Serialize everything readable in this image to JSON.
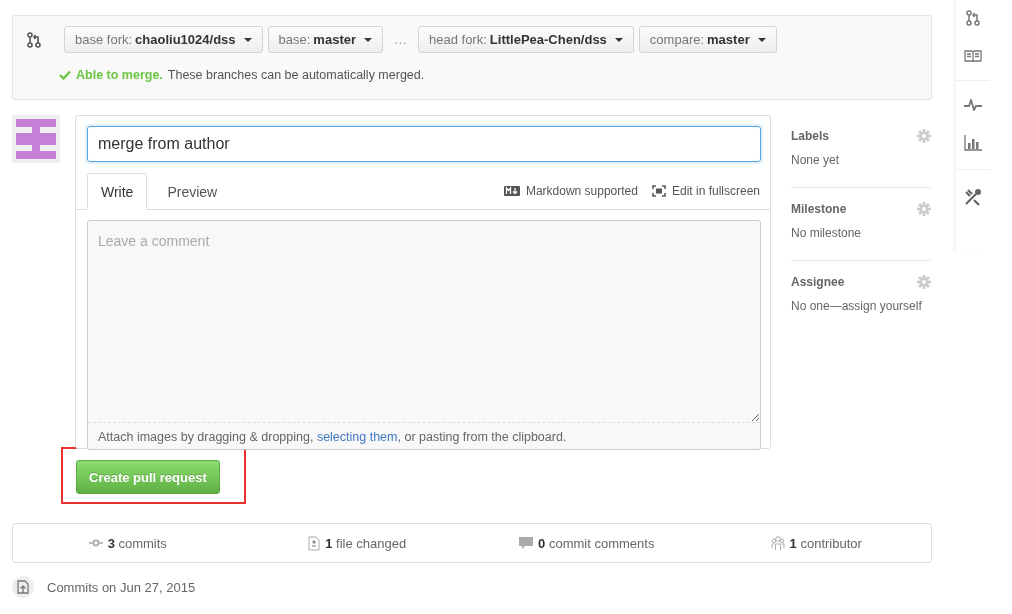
{
  "compare": {
    "selectors": [
      {
        "label": "base fork:",
        "value": "chaoliu1024/dss"
      },
      {
        "label": "base:",
        "value": "master"
      },
      {
        "label": "head fork:",
        "value": "LittlePea-Chen/dss"
      },
      {
        "label": "compare:",
        "value": "master"
      }
    ],
    "separator": "…",
    "merge_status": "Able to merge.",
    "merge_note": "These branches can be automatically merged."
  },
  "form": {
    "title_value": "merge from author",
    "tabs": [
      {
        "label": "Write",
        "selected": true
      },
      {
        "label": "Preview",
        "selected": false
      }
    ],
    "markdown_note": "Markdown supported",
    "fullscreen_link": "Edit in fullscreen",
    "comment_placeholder": "Leave a comment",
    "attach": {
      "before": "Attach images by dragging & dropping, ",
      "link": "selecting them",
      "after": ", or pasting from the clipboard."
    },
    "submit": "Create pull request"
  },
  "sidebar": [
    {
      "title": "Labels",
      "value": "None yet"
    },
    {
      "title": "Milestone",
      "value": "No milestone"
    },
    {
      "title": "Assignee",
      "value": "No one—assign yourself"
    }
  ],
  "stats": [
    {
      "kind": "commits",
      "count": "3",
      "label": "commits"
    },
    {
      "kind": "files",
      "count": "1",
      "label": "file changed"
    },
    {
      "kind": "comments",
      "count": "0",
      "label": "commit comments"
    },
    {
      "kind": "contributors",
      "count": "1",
      "label": "contributor"
    }
  ],
  "commits_heading": "Commits on Jun 27, 2015"
}
